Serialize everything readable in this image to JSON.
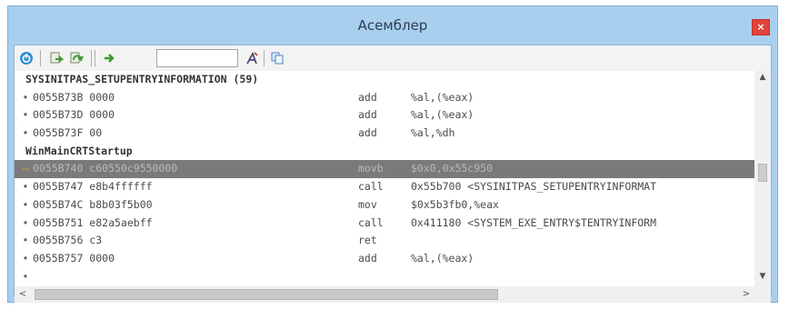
{
  "window": {
    "title": "Асемблер",
    "close_glyph": "×",
    "colors": {
      "frame": "#a9cfee",
      "selection": "#7a7a7a",
      "close": "#e0433a"
    }
  },
  "toolbar": {
    "buttons": [
      {
        "icon": "power-icon"
      },
      {
        "icon": "step-into-icon"
      },
      {
        "icon": "step-over-icon"
      },
      {
        "icon": "run-to-cursor-icon"
      },
      {
        "icon": "goto-address-icon"
      },
      {
        "icon": "copy-icon"
      }
    ],
    "address_input": {
      "value": "",
      "placeholder": ""
    }
  },
  "listing": {
    "rows": [
      {
        "type": "label",
        "text": "SYSINITPAS_SETUPENTRYINFORMATION (59)"
      },
      {
        "type": "insn",
        "marker": "•",
        "addr": "0055B73B 0000",
        "mnemonic": "add",
        "operands": "%al,(%eax)"
      },
      {
        "type": "insn",
        "marker": "•",
        "addr": "0055B73D 0000",
        "mnemonic": "add",
        "operands": "%al,(%eax)"
      },
      {
        "type": "insn",
        "marker": "•",
        "addr": "0055B73F 00",
        "mnemonic": "add",
        "operands": "%al,%dh"
      },
      {
        "type": "label",
        "text": "WinMainCRTStartup"
      },
      {
        "type": "insn",
        "marker": "⇨",
        "addr": "0055B740 c60550c9550000",
        "mnemonic": "movb",
        "operands": "$0x0,0x55c950",
        "selected": true
      },
      {
        "type": "insn",
        "marker": "•",
        "addr": "0055B747 e8b4ffffff",
        "mnemonic": "call",
        "operands": "0x55b700 <SYSINITPAS_SETUPENTRYINFORMAT"
      },
      {
        "type": "insn",
        "marker": "•",
        "addr": "0055B74C b8b03f5b00",
        "mnemonic": "mov",
        "operands": "$0x5b3fb0,%eax"
      },
      {
        "type": "insn",
        "marker": "•",
        "addr": "0055B751 e82a5aebff",
        "mnemonic": "call",
        "operands": "0x411180 <SYSTEM_EXE_ENTRY$TENTRYINFORM"
      },
      {
        "type": "insn",
        "marker": "•",
        "addr": "0055B756 c3",
        "mnemonic": "ret",
        "operands": ""
      },
      {
        "type": "insn",
        "marker": "•",
        "addr": "0055B757 0000",
        "mnemonic": "add",
        "operands": "%al,(%eax)"
      },
      {
        "type": "insn",
        "marker": "•",
        "addr": "",
        "mnemonic": "",
        "operands": ""
      }
    ]
  },
  "scrollbars": {
    "vertical": {
      "up": "▲",
      "down": "▼"
    },
    "horizontal": {
      "left": "<",
      "right": ">"
    }
  }
}
